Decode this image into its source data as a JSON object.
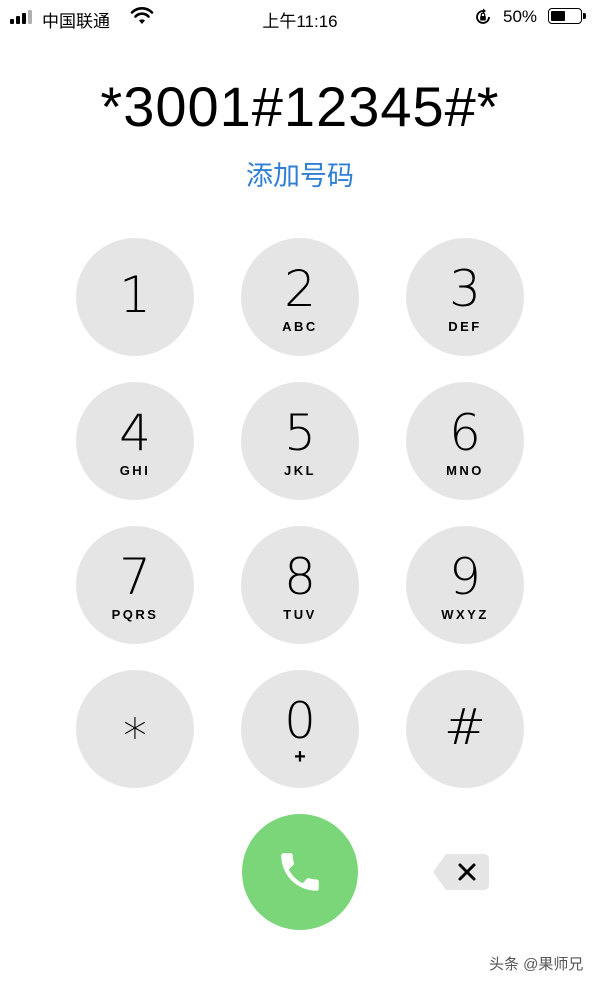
{
  "status_bar": {
    "carrier": "中国联通",
    "time": "上午11:16",
    "battery_percent": "50%",
    "battery_level": 0.5,
    "icons": [
      "signal-bars-icon",
      "wifi-icon",
      "rotation-lock-icon",
      "battery-icon"
    ]
  },
  "display": {
    "number": "*3001#12345#*",
    "add_number": "添加号码"
  },
  "keypad": [
    {
      "digit": "1",
      "letters": ""
    },
    {
      "digit": "2",
      "letters": "ABC"
    },
    {
      "digit": "3",
      "letters": "DEF"
    },
    {
      "digit": "4",
      "letters": "GHI"
    },
    {
      "digit": "5",
      "letters": "JKL"
    },
    {
      "digit": "6",
      "letters": "MNO"
    },
    {
      "digit": "7",
      "letters": "PQRS"
    },
    {
      "digit": "8",
      "letters": "TUV"
    },
    {
      "digit": "9",
      "letters": "WXYZ"
    },
    {
      "digit": "*",
      "letters": ""
    },
    {
      "digit": "0",
      "letters": "+"
    },
    {
      "digit": "#",
      "letters": ""
    }
  ],
  "actions": {
    "call_icon": "phone-icon",
    "delete_icon": "delete-backspace-icon"
  },
  "colors": {
    "key_background": "#e5e5e5",
    "call_green": "#7bd67a",
    "link_blue": "#2f7fd4"
  },
  "watermark": "头条 @果师兄"
}
